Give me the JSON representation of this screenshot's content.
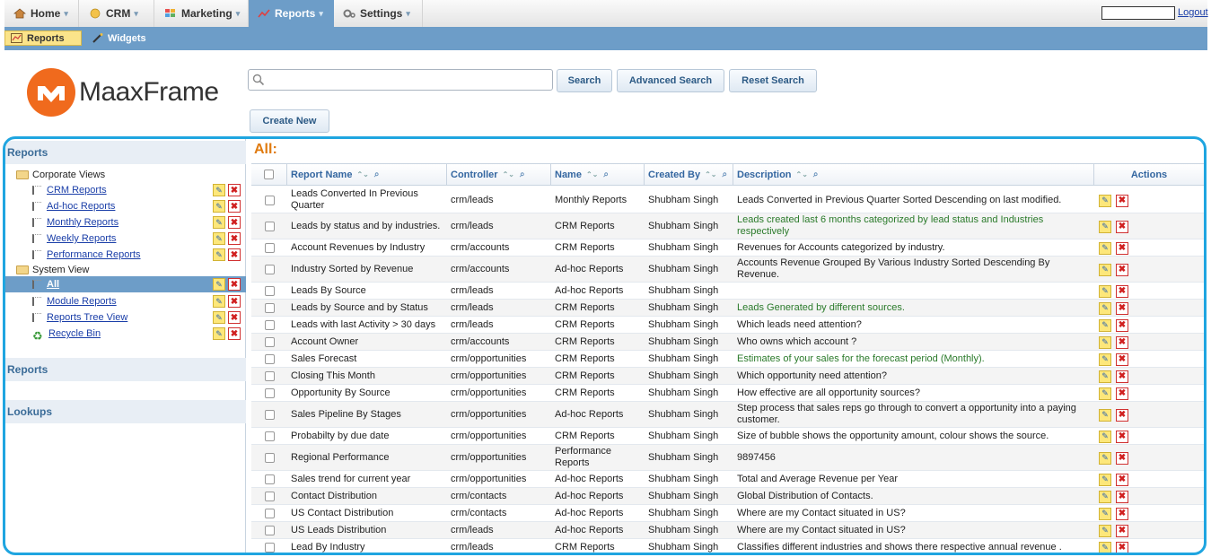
{
  "nav": {
    "tabs": [
      {
        "label": "Home",
        "icon": "home-icon",
        "active": false
      },
      {
        "label": "CRM",
        "icon": "coin-icon",
        "active": false
      },
      {
        "label": "Marketing",
        "icon": "blocks-icon",
        "active": false
      },
      {
        "label": "Reports",
        "icon": "chart-icon",
        "active": true
      },
      {
        "label": "Settings",
        "icon": "gear-icon",
        "active": false
      }
    ],
    "logout": "Logout"
  },
  "subnav": {
    "items": [
      {
        "label": "Reports",
        "active": true
      },
      {
        "label": "Widgets",
        "active": false
      }
    ]
  },
  "logo": {
    "text": "MaaxFrame"
  },
  "search": {
    "placeholder": "",
    "search_label": "Search",
    "advanced_label": "Advanced Search",
    "reset_label": "Reset Search",
    "create_label": "Create New"
  },
  "sidebar": {
    "sections": [
      "Reports",
      "Reports",
      "Lookups"
    ],
    "tree": [
      {
        "label": "Corporate Views",
        "type": "folder"
      },
      {
        "label": "CRM Reports",
        "type": "link"
      },
      {
        "label": "Ad-hoc Reports",
        "type": "link"
      },
      {
        "label": "Monthly Reports",
        "type": "link"
      },
      {
        "label": "Weekly Reports",
        "type": "link"
      },
      {
        "label": "Performance Reports",
        "type": "link"
      },
      {
        "label": "System View",
        "type": "folder"
      },
      {
        "label": "All",
        "type": "link",
        "selected": true
      },
      {
        "label": "Module Reports",
        "type": "link"
      },
      {
        "label": "Reports Tree View",
        "type": "link"
      },
      {
        "label": "Recycle Bin",
        "type": "link"
      }
    ]
  },
  "grid": {
    "title": "All:",
    "columns": [
      "Report Name",
      "Controller",
      "Name",
      "Created By",
      "Description",
      "Actions"
    ],
    "rows": [
      {
        "report": "Leads Converted In Previous Quarter",
        "controller": "crm/leads",
        "name": "Monthly Reports",
        "by": "Shubham Singh",
        "desc": "Leads Converted in Previous Quarter Sorted Descending on last modified.",
        "green": false
      },
      {
        "report": "Leads by status and by industries.",
        "controller": "crm/leads",
        "name": "CRM Reports",
        "by": "Shubham Singh",
        "desc": "Leads created last 6 months categorized by lead status and Industries respectively",
        "green": true
      },
      {
        "report": "Account Revenues by Industry",
        "controller": "crm/accounts",
        "name": "CRM Reports",
        "by": "Shubham Singh",
        "desc": "Revenues for Accounts categorized by industry.",
        "green": false
      },
      {
        "report": "Industry Sorted by Revenue",
        "controller": "crm/accounts",
        "name": "Ad-hoc Reports",
        "by": "Shubham Singh",
        "desc": "Accounts Revenue Grouped By Various Industry Sorted Descending By Revenue.",
        "green": false
      },
      {
        "report": "Leads By Source",
        "controller": "crm/leads",
        "name": "Ad-hoc Reports",
        "by": "Shubham Singh",
        "desc": "",
        "green": false
      },
      {
        "report": "Leads by Source and by Status",
        "controller": "crm/leads",
        "name": "CRM Reports",
        "by": "Shubham Singh",
        "desc": "Leads Generated by different sources.",
        "green": true
      },
      {
        "report": "Leads with last Activity > 30 days",
        "controller": "crm/leads",
        "name": "CRM Reports",
        "by": "Shubham Singh",
        "desc": "Which leads need attention?",
        "green": false
      },
      {
        "report": "Account Owner",
        "controller": "crm/accounts",
        "name": "CRM Reports",
        "by": "Shubham Singh",
        "desc": "Who owns which account ?",
        "green": false
      },
      {
        "report": "Sales Forecast",
        "controller": "crm/opportunities",
        "name": "CRM Reports",
        "by": "Shubham Singh",
        "desc": "Estimates of your sales for the forecast period (Monthly).",
        "green": true
      },
      {
        "report": "Closing This Month",
        "controller": "crm/opportunities",
        "name": "CRM Reports",
        "by": "Shubham Singh",
        "desc": "Which opportunity need attention?",
        "green": false
      },
      {
        "report": "Opportunity By Source",
        "controller": "crm/opportunities",
        "name": "CRM Reports",
        "by": "Shubham Singh",
        "desc": "How effective are all opportunity sources?",
        "green": false
      },
      {
        "report": "Sales Pipeline By Stages",
        "controller": "crm/opportunities",
        "name": "Ad-hoc Reports",
        "by": "Shubham Singh",
        "desc": "Step process that sales reps go through to convert a opportunity into a paying customer.",
        "green": false
      },
      {
        "report": "Probabilty by due date",
        "controller": "crm/opportunities",
        "name": "CRM Reports",
        "by": "Shubham Singh",
        "desc": "Size of bubble shows the opportunity amount, colour shows the source.",
        "green": false
      },
      {
        "report": "Regional Performance",
        "controller": "crm/opportunities",
        "name": "Performance Reports",
        "by": "Shubham Singh",
        "desc": "9897456",
        "green": false
      },
      {
        "report": "Sales trend for current year",
        "controller": "crm/opportunities",
        "name": "Ad-hoc Reports",
        "by": "Shubham Singh",
        "desc": "Total and Average Revenue per Year",
        "green": false
      },
      {
        "report": "Contact Distribution",
        "controller": "crm/contacts",
        "name": "Ad-hoc Reports",
        "by": "Shubham Singh",
        "desc": "Global Distribution of Contacts.",
        "green": false
      },
      {
        "report": "US Contact Distribution",
        "controller": "crm/contacts",
        "name": "Ad-hoc Reports",
        "by": "Shubham Singh",
        "desc": "Where are my Contact situated in US?",
        "green": false
      },
      {
        "report": "US Leads Distribution",
        "controller": "crm/leads",
        "name": "Ad-hoc Reports",
        "by": "Shubham Singh",
        "desc": "Where are my Contact situated in US?",
        "green": false
      },
      {
        "report": "Lead By Industry",
        "controller": "crm/leads",
        "name": "CRM Reports",
        "by": "Shubham Singh",
        "desc": "Classifies different industries and shows there respective annual revenue .",
        "green": false
      }
    ]
  },
  "colors": {
    "accent": "#6d9dc8",
    "frame": "#1fa5e0",
    "title": "#e07b10",
    "logo": "#f06a1d"
  }
}
